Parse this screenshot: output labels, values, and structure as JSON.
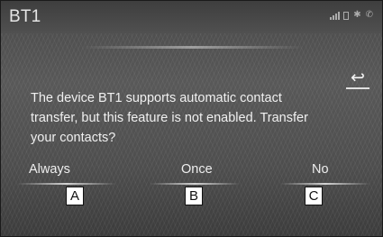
{
  "header": {
    "title": "BT1",
    "status_icons": [
      "signal-bars-icon",
      "battery-icon",
      "bluetooth-icon",
      "phone-icon"
    ]
  },
  "back_button": {
    "icon": "back-arrow-icon",
    "glyph": "↩"
  },
  "dialog": {
    "message_lines": [
      "The device BT1 supports automatic contact",
      "transfer, but this feature is not enabled. Transfer",
      "your contacts?"
    ]
  },
  "options": {
    "always": "Always",
    "once": "Once",
    "no": "No"
  },
  "callouts": {
    "a": "A",
    "b": "B",
    "c": "C"
  }
}
